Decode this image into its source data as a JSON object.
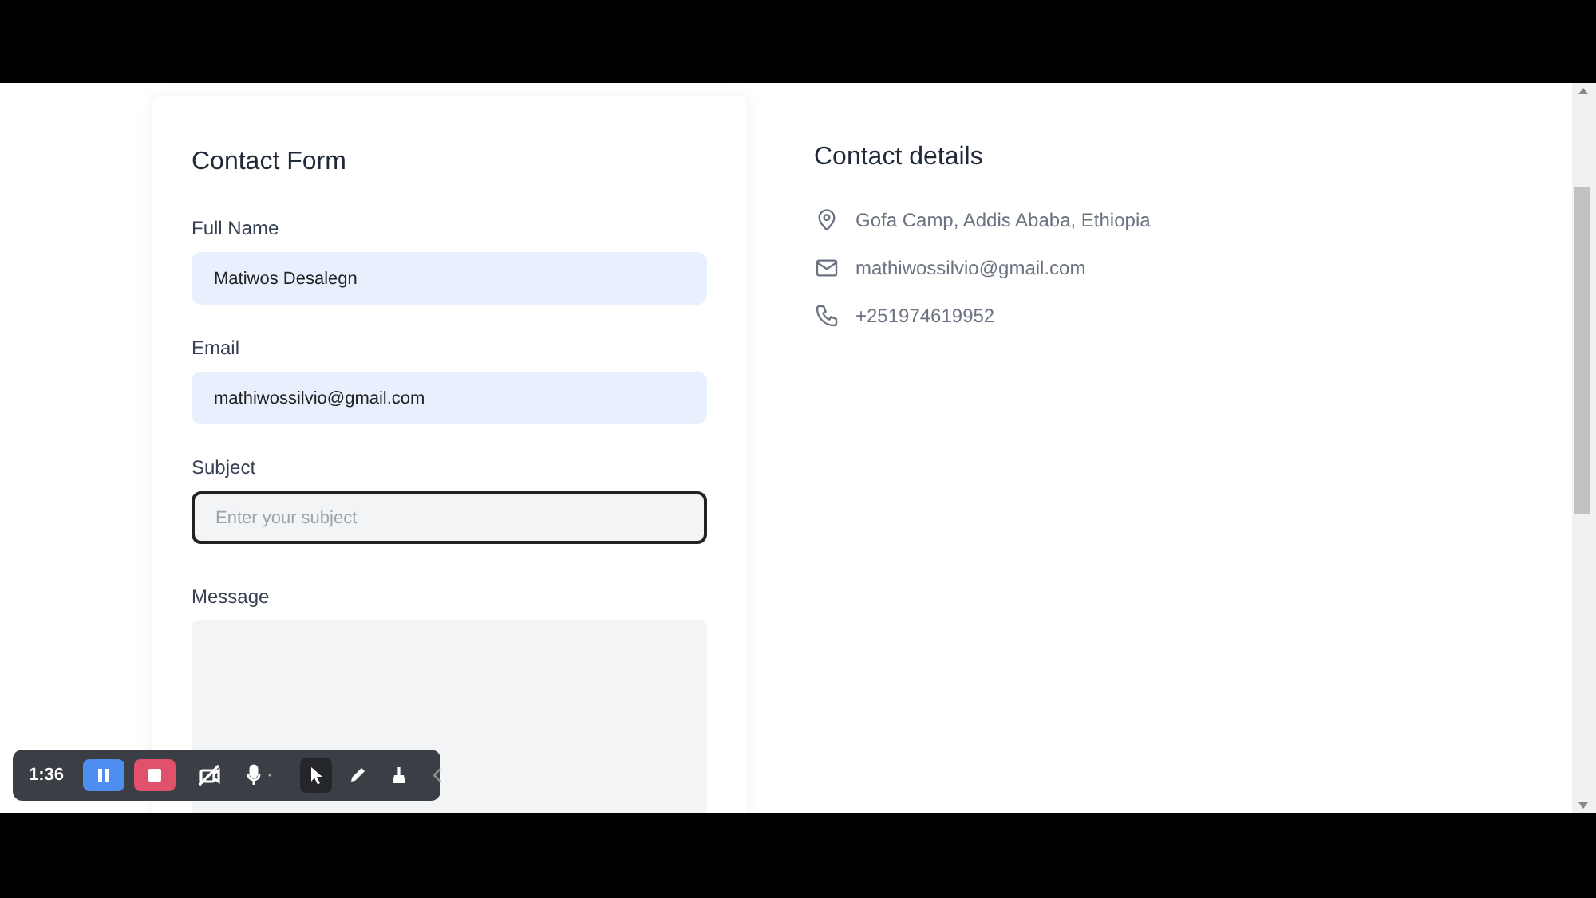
{
  "form": {
    "title": "Contact Form",
    "fields": [
      {
        "kind": "input",
        "label": "Full Name",
        "value": "Matiwos Desalegn",
        "focused": false
      },
      {
        "kind": "input",
        "label": "Email",
        "value": "mathiwossilvio@gmail.com",
        "focused": false
      },
      {
        "kind": "input",
        "label": "Subject",
        "placeholder": "Enter your subject",
        "focused": true
      },
      {
        "kind": "textarea",
        "label": "Message",
        "focused": false
      }
    ]
  },
  "contact_details": {
    "title": "Contact details",
    "items": [
      {
        "kind": "location",
        "text": "Gofa Camp, Addis Ababa, Ethiopia"
      },
      {
        "kind": "email",
        "text": "mathiwossilvio@gmail.com"
      },
      {
        "kind": "phone",
        "text": "+251974619952"
      }
    ]
  },
  "recorder": {
    "time": "1:36",
    "tools": [
      {
        "kind": "pause",
        "selected": false
      },
      {
        "kind": "stop",
        "selected": false
      },
      {
        "kind": "camera-off",
        "selected": false
      },
      {
        "kind": "mic",
        "selected": false
      },
      {
        "kind": "pointer",
        "selected": true
      },
      {
        "kind": "pen",
        "selected": false
      },
      {
        "kind": "broom",
        "selected": false
      },
      {
        "kind": "collapse",
        "selected": false
      }
    ]
  }
}
